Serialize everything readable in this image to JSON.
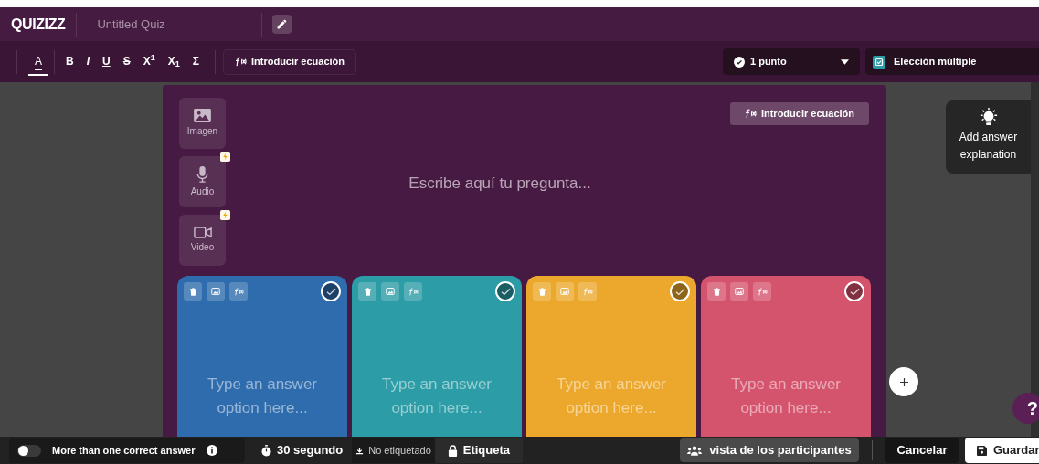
{
  "header": {
    "logo": "QUIZIZZ",
    "title_placeholder": "Untitled Quiz"
  },
  "toolbar": {
    "format_buttons": [
      {
        "kind": "color",
        "label": "A",
        "selected": true
      },
      {
        "kind": "bold",
        "label": "B",
        "selected": false
      },
      {
        "kind": "italic",
        "label": "I",
        "selected": false
      },
      {
        "kind": "underline",
        "label": "U",
        "selected": false
      },
      {
        "kind": "strike",
        "label": "S",
        "selected": false
      },
      {
        "kind": "plain",
        "label": "X$^{1}$",
        "selected": false
      },
      {
        "kind": "plain",
        "label": "X$_{1}$",
        "selected": false
      },
      {
        "kind": "plain",
        "label": "Σ",
        "selected": false
      }
    ],
    "equation_button": "Introducir ecuación",
    "points": "1 punto",
    "question_type": "Elección múltiple"
  },
  "media_buttons": [
    {
      "label": "Imagen",
      "kind": "image",
      "premium": false
    },
    {
      "label": "Audio",
      "kind": "audio",
      "premium": true
    },
    {
      "label": "Video",
      "kind": "video",
      "premium": true
    }
  ],
  "question": {
    "equation_button": "Introducir ecuación",
    "placeholder": "Escribe aquí tu pregunta..."
  },
  "answers": [
    {
      "color": "#2f6cad",
      "placeholder": "Type an answer option here...",
      "correct": false
    },
    {
      "color": "#2c9ca6",
      "placeholder": "Type an answer option here...",
      "correct": false
    },
    {
      "color": "#eca82c",
      "placeholder": "Type an answer option here...",
      "correct": false
    },
    {
      "color": "#d5546d",
      "placeholder": "Type an answer option here...",
      "correct": false
    }
  ],
  "explanation": "Add answer explanation",
  "help": "?",
  "footer": {
    "multiple_correct": {
      "label": "More than one correct answer",
      "on": false
    },
    "time": "30 segundo",
    "tag_status": "No etiquetado",
    "tag": "Etiqueta",
    "participants_view": "vista de los participantes",
    "cancel": "Cancelar",
    "save": "Guardar"
  }
}
